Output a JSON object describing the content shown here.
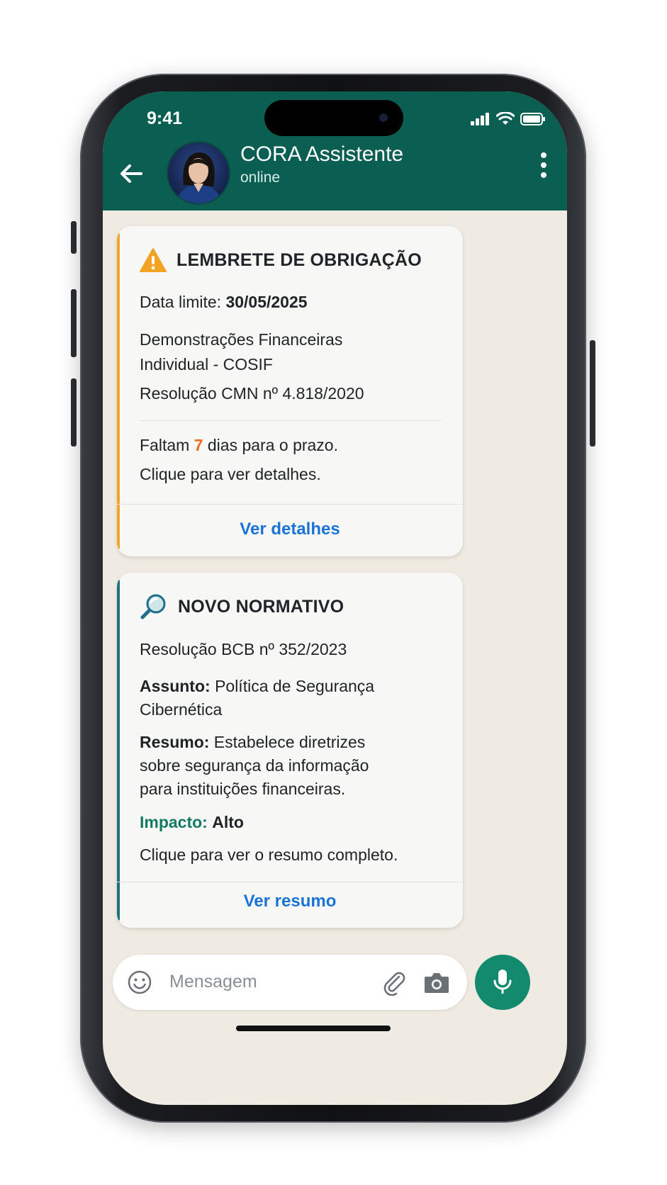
{
  "status_bar": {
    "time": "9:41"
  },
  "header": {
    "contact_name": "CORA Assistente",
    "contact_status": "online",
    "icons": [
      "back-arrow-icon",
      "avatar",
      "more-vert-icon"
    ]
  },
  "messages": [
    {
      "icon": "warning-icon",
      "accent_color": "#f0a52b",
      "title": "LEMBRETE DE OBRIGAÇÃO",
      "deadline_label": "Data limite:",
      "deadline_value": "30/05/2025",
      "doc_line1": "Demonstrações Financeiras",
      "doc_line2": "Individual - COSIF",
      "resolution": "Resolução CMN nº 4.818/2020",
      "remaining_prefix": "Faltam",
      "remaining_days": "7",
      "remaining_suffix": "dias para o prazo.",
      "hint": "Clique para ver detalhes.",
      "action": "Ver detalhes"
    },
    {
      "icon": "magnifier-icon",
      "accent_color": "#1f6f78",
      "title": "NOVO NORMATIVO",
      "resolution": "Resolução BCB nº 352/2023",
      "subject_label": "Assunto:",
      "subject_line1": "Política de Segurança",
      "subject_line2": "Cibernética",
      "summary_label": "Resumo:",
      "summary_line1": "Estabelece diretrizes",
      "summary_line2": "sobre segurança da informação",
      "summary_line3": "para instituições financeiras.",
      "impact_label": "Impacto:",
      "impact_value": "Alto",
      "hint": "Clique para ver o resumo completo.",
      "action": "Ver resumo"
    }
  ],
  "composer": {
    "placeholder": "Mensagem",
    "icons": [
      "emoji-icon",
      "attach-icon",
      "camera-icon",
      "mic-icon"
    ]
  },
  "colors": {
    "header": "#0b5f52",
    "link": "#1a73d9",
    "mic": "#138a6e",
    "days": "#ef6c1e",
    "impact": "#137a63"
  }
}
